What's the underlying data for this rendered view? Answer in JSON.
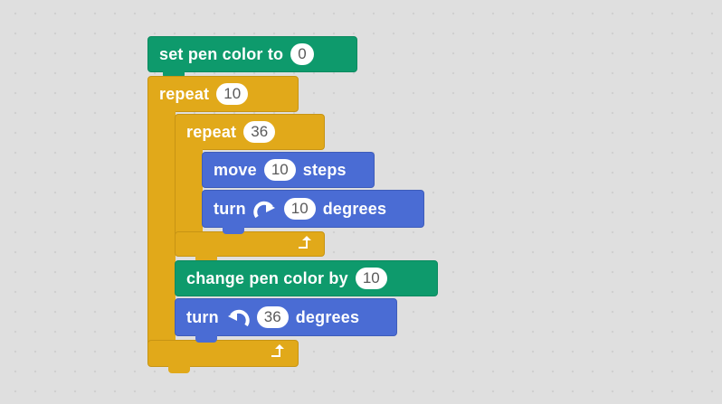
{
  "script": {
    "set_pen_color": {
      "label": "set pen color to",
      "value": "0",
      "color": "#0e9a6c"
    },
    "outer_repeat": {
      "label": "repeat",
      "value": "10",
      "color": "#e1a91a"
    },
    "inner_repeat": {
      "label": "repeat",
      "value": "36",
      "color": "#e1a91a"
    },
    "move": {
      "label_before": "move",
      "value": "10",
      "label_after": "steps",
      "color": "#4a6cd4"
    },
    "turn_right": {
      "label_before": "turn",
      "icon": "rotate-clockwise-icon",
      "value": "10",
      "label_after": "degrees"
    },
    "change_pen_color": {
      "label": "change pen color by",
      "value": "10"
    },
    "turn_left": {
      "label_before": "turn",
      "icon": "rotate-counterclockwise-icon",
      "value": "36",
      "label_after": "degrees"
    }
  }
}
